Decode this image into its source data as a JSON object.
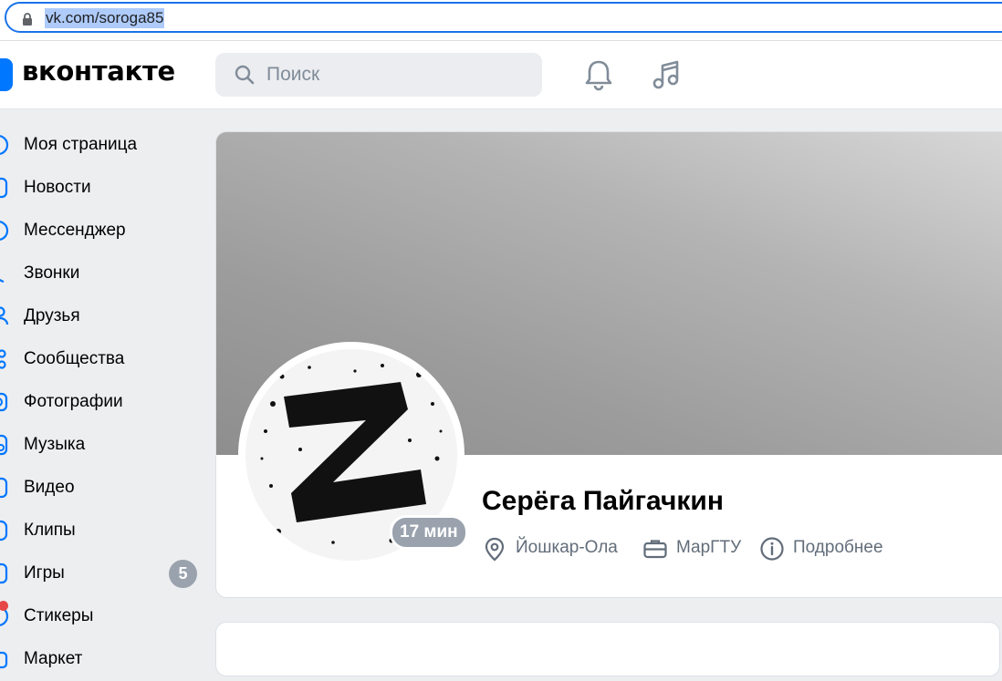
{
  "browser": {
    "url": "vk.com/soroga85"
  },
  "header": {
    "logo_text": "вконтакте",
    "search_placeholder": "Поиск"
  },
  "sidebar": {
    "items": [
      {
        "label": "Моя страница",
        "icon": "user-circle-icon"
      },
      {
        "label": "Новости",
        "icon": "news-icon"
      },
      {
        "label": "Мессенджер",
        "icon": "message-icon"
      },
      {
        "label": "Звонки",
        "icon": "phone-icon"
      },
      {
        "label": "Друзья",
        "icon": "friends-icon"
      },
      {
        "label": "Сообщества",
        "icon": "communities-icon"
      },
      {
        "label": "Фотографии",
        "icon": "photo-icon"
      },
      {
        "label": "Музыка",
        "icon": "music-icon"
      },
      {
        "label": "Видео",
        "icon": "video-icon"
      },
      {
        "label": "Клипы",
        "icon": "clips-icon"
      },
      {
        "label": "Игры",
        "icon": "games-icon",
        "badge": "5"
      },
      {
        "label": "Стикеры",
        "icon": "stickers-icon"
      },
      {
        "label": "Маркет",
        "icon": "market-icon"
      }
    ]
  },
  "profile": {
    "name": "Серёга Пайгачкин",
    "online_status": "17 мин",
    "city": "Йошкар-Ола",
    "education": "МарГТУ",
    "more_label": "Подробнее"
  },
  "colors": {
    "accent": "#0077ff",
    "badge": "#99a2ad",
    "background": "#edeef0"
  }
}
